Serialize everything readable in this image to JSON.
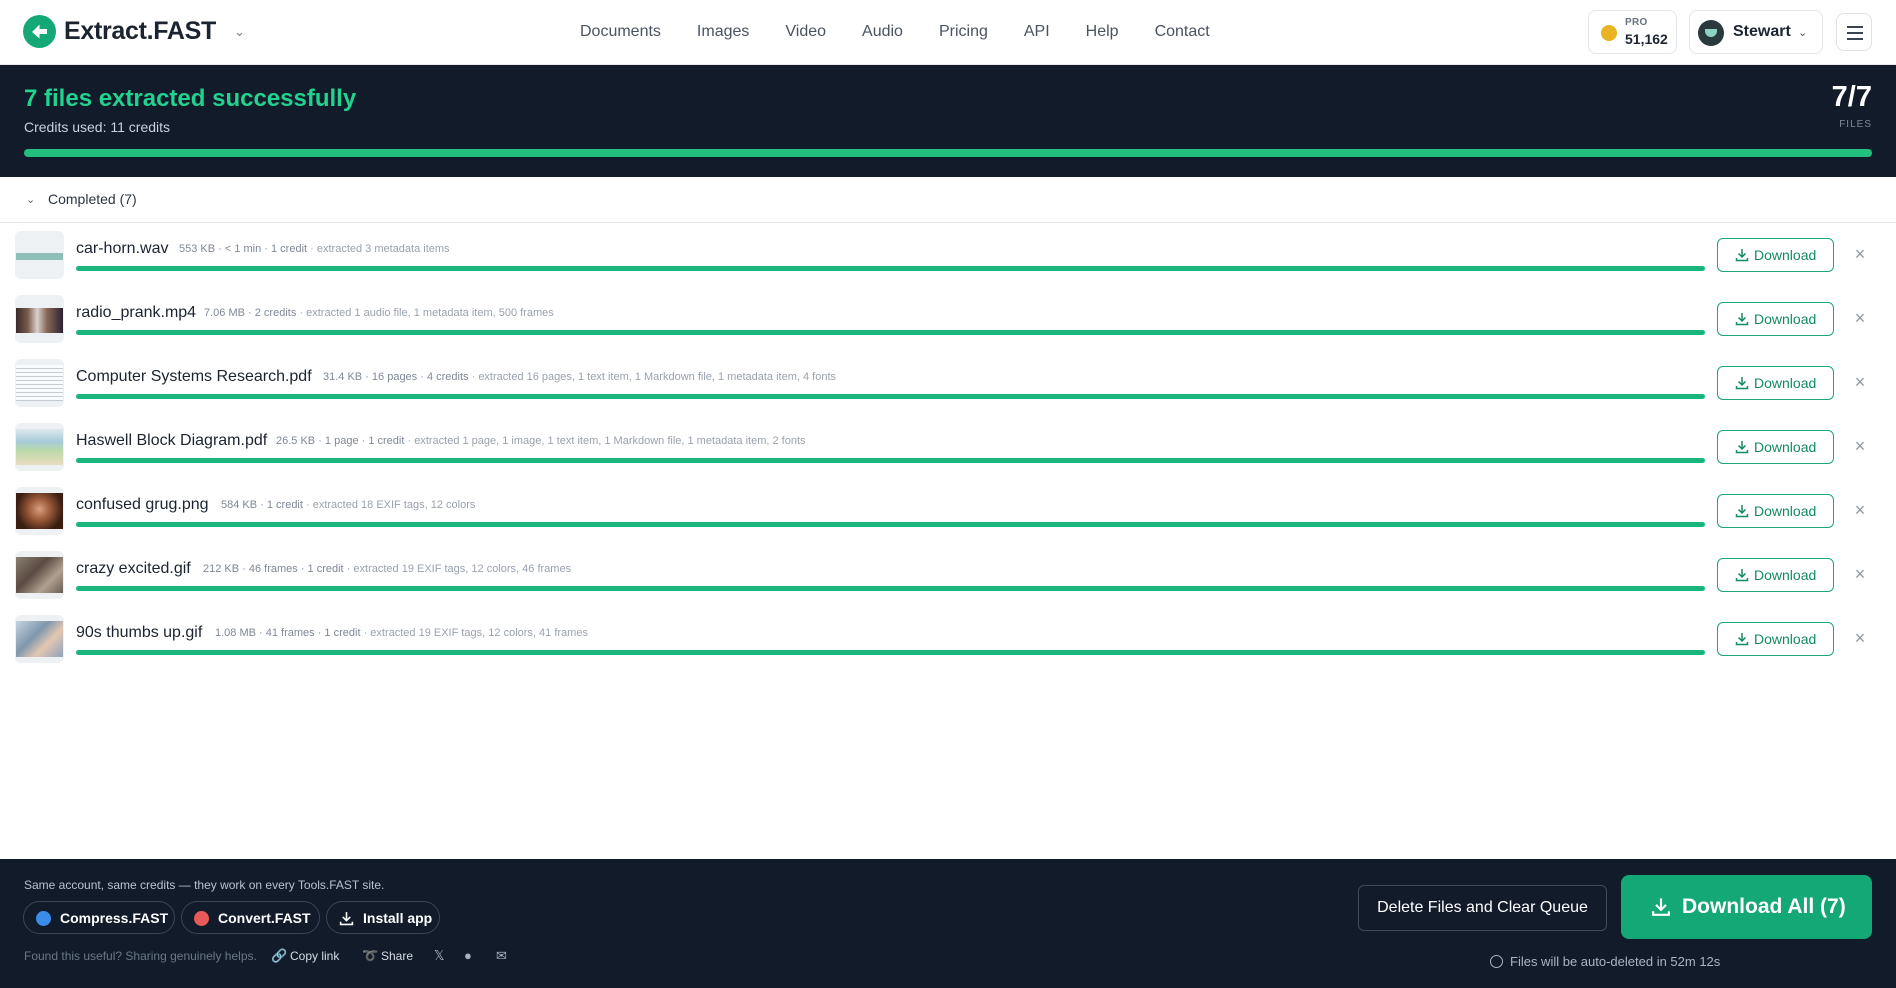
{
  "header": {
    "logo": "Extract.FAST",
    "nav": [
      "Documents",
      "Images",
      "Video",
      "Audio",
      "Pricing",
      "API",
      "Help",
      "Contact"
    ],
    "plan_label": "PRO",
    "credits": "51,162",
    "user_name": "Stewart",
    "accent_color": "#14a877"
  },
  "banner": {
    "title": "7 files extracted successfully",
    "credits_used": "Credits used: 11 credits",
    "count": "7/7",
    "count_label": "FILES",
    "progress": 1.0
  },
  "section": {
    "label": "Completed (7)"
  },
  "files": [
    {
      "name": "car-horn.wav",
      "meta": "553 KB · < 1 min · 1 credit",
      "extracted": "· extracted 3 metadata items",
      "download_label": "Download",
      "progress": 1.0,
      "thumb": "waveform"
    },
    {
      "name": "radio_prank.mp4",
      "meta": "7.06 MB · 2 credits",
      "extracted": "· extracted 1 audio file, 1 metadata item, 500 frames",
      "download_label": "Download",
      "progress": 1.0,
      "thumb": "video"
    },
    {
      "name": "Computer Systems Research.pdf",
      "meta": "31.4 KB · 16 pages · 4 credits",
      "extracted": "· extracted 16 pages, 1 text item, 1 Markdown file, 1 metadata item, 4 fonts",
      "download_label": "Download",
      "progress": 1.0,
      "thumb": "document"
    },
    {
      "name": "Haswell Block Diagram.pdf",
      "meta": "26.5 KB · 1 page · 1 credit",
      "extracted": "· extracted 1 page, 1 image, 1 text item, 1 Markdown file, 1 metadata item, 2 fonts",
      "download_label": "Download",
      "progress": 1.0,
      "thumb": "diagram"
    },
    {
      "name": "confused grug.png",
      "meta": "584 KB · 1 credit",
      "extracted": "· extracted 18 EXIF tags, 12 colors",
      "download_label": "Download",
      "progress": 1.0,
      "thumb": "photo-warm"
    },
    {
      "name": "crazy excited.gif",
      "meta": "212 KB · 46 frames · 1 credit",
      "extracted": "· extracted 19 EXIF tags, 12 colors, 46 frames",
      "download_label": "Download",
      "progress": 1.0,
      "thumb": "photo-grey"
    },
    {
      "name": "90s thumbs up.gif",
      "meta": "1.08 MB · 41 frames · 1 credit",
      "extracted": "· extracted 19 EXIF tags, 12 colors, 41 frames",
      "download_label": "Download",
      "progress": 1.0,
      "thumb": "photo-blue"
    }
  ],
  "footer": {
    "note": "Same account, same credits — they work on every Tools.FAST site.",
    "chips": [
      "Compress.FAST",
      "Convert.FAST",
      "Install app"
    ],
    "share_prompt": "Found this useful? Sharing genuinely helps.",
    "copy_link": "Copy link",
    "share": "Share",
    "delete_label": "Delete Files and Clear Queue",
    "download_all_label": "Download All (7)",
    "auto_delete": "Files will be auto-deleted in 52m 12s"
  }
}
